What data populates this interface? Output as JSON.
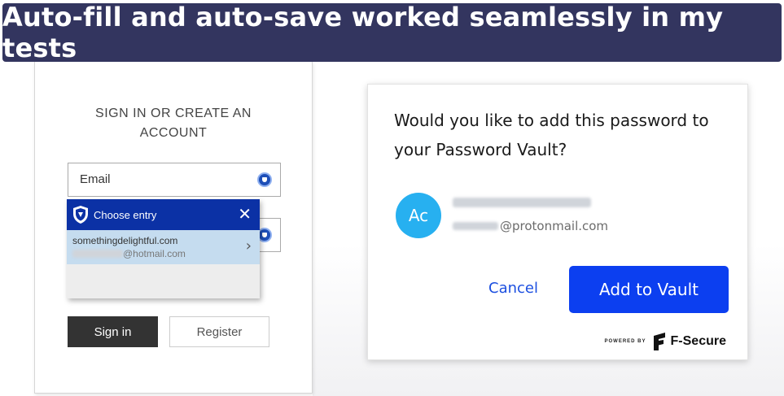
{
  "banner": {
    "text": "Auto-fill and auto-save worked seamlessly in my tests"
  },
  "signin": {
    "title": "SIGN IN OR CREATE AN ACCOUNT",
    "email_placeholder": "Email",
    "signin_label": "Sign in",
    "register_label": "Register"
  },
  "chooser": {
    "title": "Choose entry",
    "close_glyph": "✕",
    "entry": {
      "site": "somethingdelightful.com",
      "email_suffix": "@hotmail.com",
      "chevron": "›"
    }
  },
  "vault": {
    "question": "Would you like to add this password to your Password Vault?",
    "avatar_initials": "Ac",
    "email_suffix": "@protonmail.com",
    "cancel_label": "Cancel",
    "add_label": "Add to Vault",
    "powered_by": "POWERED BY",
    "brand": "F-Secure"
  },
  "colors": {
    "banner_bg": "#33355f",
    "chooser_header": "#0b31a5",
    "entry_highlight": "#c5dcef",
    "avatar": "#27b0f0",
    "add_button": "#0c3ff0",
    "cancel_text": "#1c4fe0"
  },
  "icons": {
    "field_icon": "shield-icon",
    "chooser_logo": "shield-icon",
    "close": "close-icon",
    "entry_arrow": "chevron-right-icon",
    "brand_logo": "f-secure-logo"
  }
}
